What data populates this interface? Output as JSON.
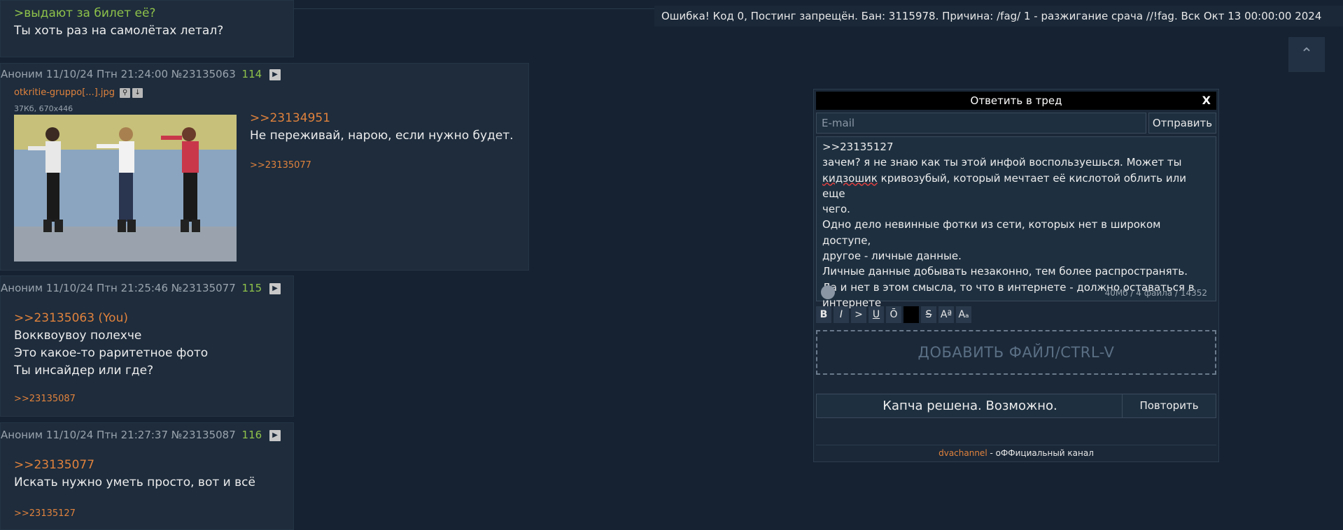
{
  "posts": [
    {
      "greentext": ">выдают за билет её?",
      "text": "Ты хоть раз на самолётах летал?"
    },
    {
      "author": "Аноним",
      "date": "11/10/24 Птн 21:24:00",
      "id": "№23135063",
      "num": "114",
      "file": {
        "name": "otkritie-gruppo[...].jpg",
        "meta": "37Кб, 670x446"
      },
      "reply_link": ">>23134951",
      "text": "Не переживай, нарою, если нужно будет.",
      "backlink": ">>23135077"
    },
    {
      "author": "Аноним",
      "date": "11/10/24 Птн 21:25:46",
      "id": "№23135077",
      "num": "115",
      "reply_link": ">>23135063 (You)",
      "lines": [
        "Вокквоувоу полехче",
        "Это какое-то раритетное фото",
        "Ты инсайдер или где?"
      ],
      "backlink": ">>23135087"
    },
    {
      "author": "Аноним",
      "date": "11/10/24 Птн 21:27:37",
      "id": "№23135087",
      "num": "116",
      "reply_link": ">>23135077",
      "text": "Искать нужно уметь просто, вот и всё",
      "backlink": ">>23135127"
    }
  ],
  "error": "Ошибка! Код 0, Постинг запрещён. Бан: 3115978. Причина: /fag/ 1 - разжигание срача //!fag. Вск Окт 13 00:00:00 2024",
  "form": {
    "title": "Ответить в тред",
    "close": "X",
    "email_placeholder": "E-mail",
    "send": "Отправить",
    "text_line1": ">>23135127",
    "text_line2": "зачем? я не знаю как ты этой инфой воспользуешься. Может ты",
    "text_misspelled": "кидзошик",
    "text_line3_rest": " кривозубый, который мечтает её кислотой облить или еще",
    "text_line4": "чего.",
    "text_line5": "Одно дело невинные фотки из сети, которых нет в широком доступе,",
    "text_line6": "другое - личные данные.",
    "text_line7": "Личные данные добывать незаконно, тем более распространять.",
    "text_line8": "Да и нет в этом смысла, то что в интернете - должно оставаться в",
    "text_line9": "интернете",
    "limits": "40Мб / 4 файла / 14352",
    "markup": [
      "B",
      "I",
      ">",
      "U",
      "Ō",
      "",
      "S",
      "Aª",
      "Aₐ"
    ],
    "dropzone": "ДОБАВИТЬ ФАЙЛ/CTRL-V",
    "captcha": "Капча решена. Возможно.",
    "retry": "Повторить",
    "footer_channel": "dvachannel",
    "footer_text": " - оФФициальный канал"
  },
  "scroll_top_icon": "chevron-up-icon",
  "colors": {
    "background": "#162232",
    "post": "#1e2c3c",
    "link": "#e0823c",
    "greentext": "#8fc24a"
  }
}
